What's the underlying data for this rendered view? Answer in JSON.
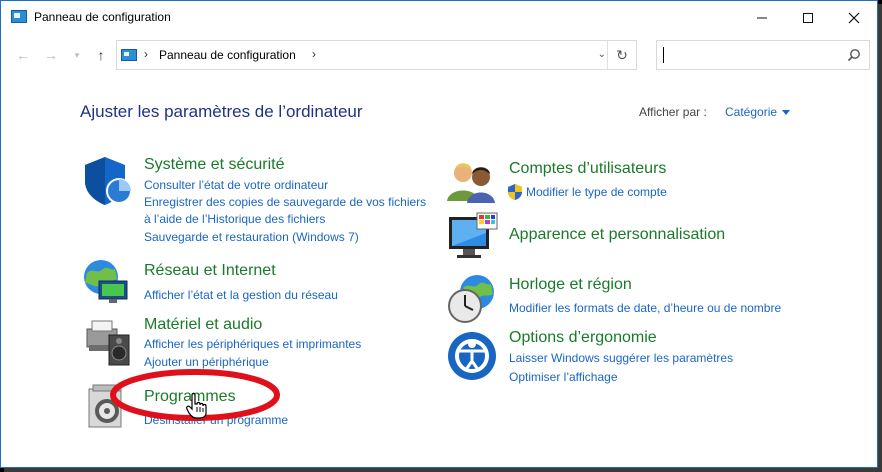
{
  "window": {
    "title": "Panneau de configuration"
  },
  "address": {
    "crumb": "Panneau de configuration",
    "search_placeholder": ""
  },
  "page": {
    "heading": "Ajuster les paramètres de l’ordinateur",
    "view_by_label": "Afficher par :",
    "view_by_value": "Catégorie"
  },
  "left": [
    {
      "title": "Système et sécurité",
      "icon": "shield-icon",
      "links": [
        "Consulter l’état de votre ordinateur",
        "Enregistrer des copies de sauvegarde de vos fichiers",
        "à l’aide de l’Historique des fichiers",
        "Sauvegarde et restauration (Windows 7)"
      ]
    },
    {
      "title": "Réseau et Internet",
      "icon": "network-globe-icon",
      "links": [
        "Afficher l’état et la gestion du réseau"
      ]
    },
    {
      "title": "Matériel et audio",
      "icon": "printer-speaker-icon",
      "links": [
        "Afficher les périphériques et imprimantes",
        "Ajouter un périphérique"
      ]
    },
    {
      "title": "Programmes",
      "icon": "programs-disc-icon",
      "links": [
        "Désinstaller un programme"
      ]
    }
  ],
  "right": [
    {
      "title": "Comptes d’utilisateurs",
      "icon": "users-icon",
      "links": [
        "Modifier le type de compte"
      ]
    },
    {
      "title": "Apparence et personnalisation",
      "icon": "monitor-palette-icon",
      "links": []
    },
    {
      "title": "Horloge et région",
      "icon": "clock-globe-icon",
      "links": [
        "Modifier les formats de date, d’heure ou de nombre"
      ]
    },
    {
      "title": "Options d’ergonomie",
      "icon": "accessibility-icon",
      "links": [
        "Laisser Windows suggérer les paramètres",
        "Optimiser l’affichage"
      ]
    }
  ],
  "colors": {
    "category_title": "#1a7a2a",
    "link": "#1a66c4",
    "heading": "#1e3287",
    "annotation": "#e0101a"
  }
}
